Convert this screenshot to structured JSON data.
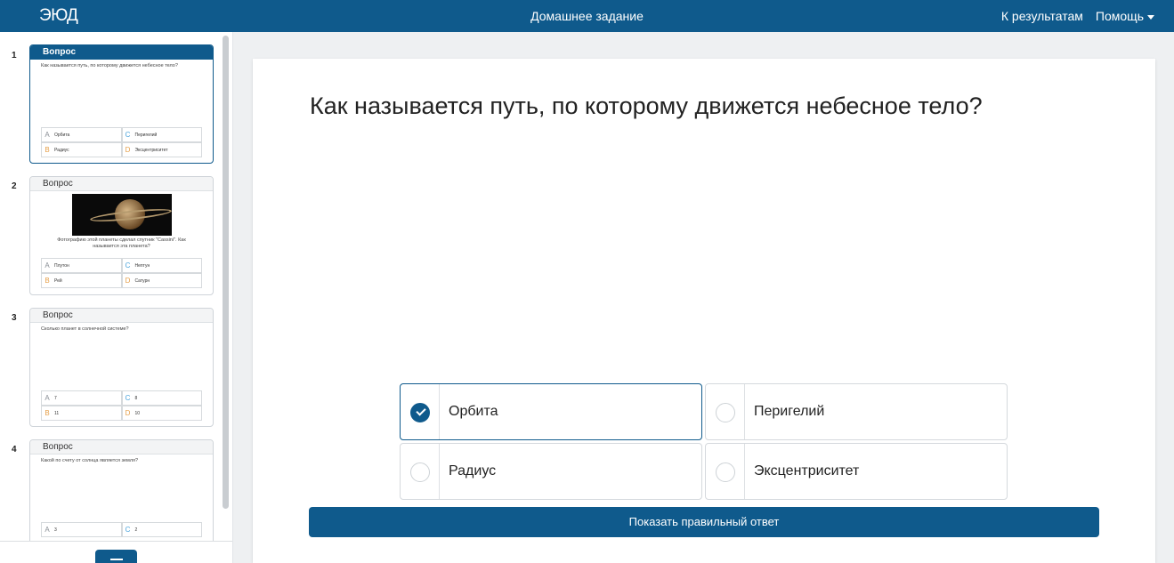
{
  "topbar": {
    "logo": "ЭЮД",
    "title": "Домашнее задание",
    "results_link": "К результатам",
    "help_menu": "Помощь"
  },
  "sidebar": {
    "questions": [
      {
        "number": "1",
        "header": "Вопрос",
        "text": "Как называется путь, по которому движется небесное тело?",
        "options": [
          {
            "letter": "A",
            "text": "Орбита"
          },
          {
            "letter": "C",
            "text": "Перигелий"
          },
          {
            "letter": "B",
            "text": "Радиус"
          },
          {
            "letter": "D",
            "text": "Эксцентриситет"
          }
        ]
      },
      {
        "number": "2",
        "header": "Вопрос",
        "text": "Фотографию этой планеты сделал спутник \"Cassini\". Как называется эта планета?",
        "options": [
          {
            "letter": "A",
            "text": "Плутон"
          },
          {
            "letter": "C",
            "text": "Нептун"
          },
          {
            "letter": "B",
            "text": "Рей"
          },
          {
            "letter": "D",
            "text": "Сатурн"
          }
        ]
      },
      {
        "number": "3",
        "header": "Вопрос",
        "text": "Сколько планет в солнечной системе?",
        "options": [
          {
            "letter": "A",
            "text": "7"
          },
          {
            "letter": "C",
            "text": "8"
          },
          {
            "letter": "B",
            "text": "11"
          },
          {
            "letter": "D",
            "text": "10"
          }
        ]
      },
      {
        "number": "4",
        "header": "Вопрос",
        "text": "Какой по счету от солнца является земля?",
        "options": [
          {
            "letter": "A",
            "text": "3"
          },
          {
            "letter": "C",
            "text": "2"
          }
        ]
      }
    ]
  },
  "main": {
    "question": "Как называется путь, по которому движется небесное тело?",
    "answers": [
      {
        "text": "Орбита",
        "selected": true
      },
      {
        "text": "Перигелий",
        "selected": false
      },
      {
        "text": "Радиус",
        "selected": false
      },
      {
        "text": "Эксцентриситет",
        "selected": false
      }
    ],
    "show_answer_button": "Показать правильный ответ"
  },
  "colors": {
    "brand": "#0f5a8c",
    "letter_a": "#8a8f96",
    "letter_b": "#e6a04a",
    "letter_c": "#4aa4dc",
    "letter_d": "#e6a04a"
  }
}
